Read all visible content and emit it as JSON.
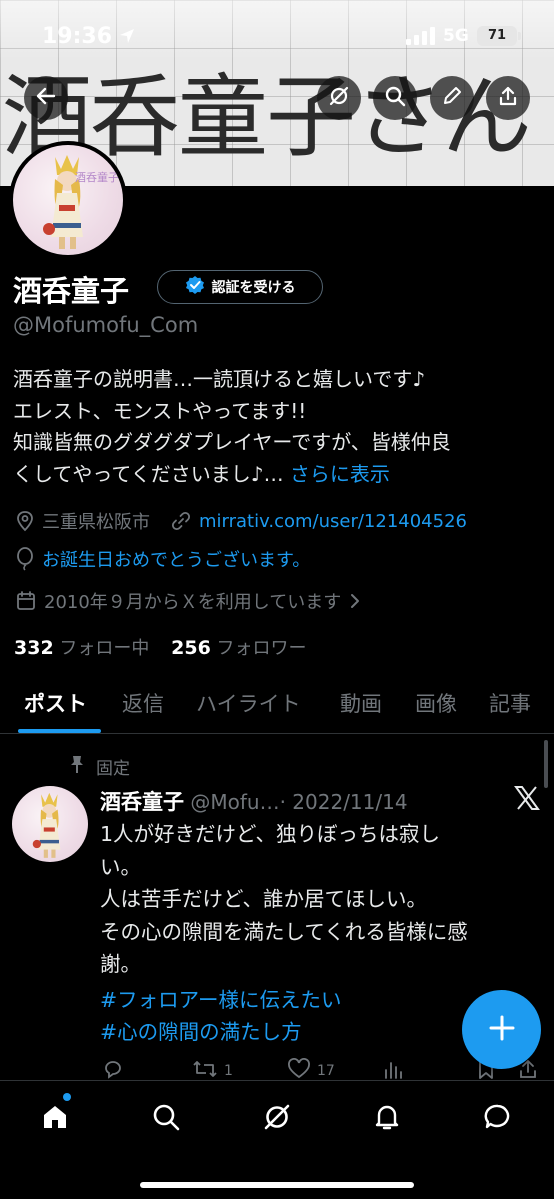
{
  "status_bar": {
    "time": "19:36",
    "network": "5G",
    "battery": "71"
  },
  "banner": {
    "text": "酒呑童子さん"
  },
  "header": {
    "back_icon": "arrow-left-icon",
    "grok_icon": "grok-icon",
    "search_icon": "search-icon",
    "edit_icon": "pencil-icon",
    "share_icon": "share-icon"
  },
  "profile": {
    "avatar_label": "酒呑童子",
    "display_name": "酒呑童子",
    "verify_button": "認証を受ける",
    "handle": "@Mofumofu_Com",
    "bio": "酒呑童子の説明書…一読頂けると嬉しいです♪\nエレスト、モンストやってます!!\n知識皆無のグダグダプレイヤーですが、皆様仲良\nくしてやってくださいまし♪… ",
    "bio_more": "さらに表示",
    "location": "三重県松阪市",
    "website": "mirrativ.com/user/121404526",
    "birthday": "お誕生日おめでとうございます。",
    "joined": "2010年９月からＸを利用しています",
    "following_count": "332",
    "following_label": "フォロー中",
    "followers_count": "256",
    "followers_label": "フォロワー"
  },
  "tabs": [
    "ポスト",
    "返信",
    "ハイライト",
    "動画",
    "画像",
    "記事"
  ],
  "active_tab": "ポスト",
  "post": {
    "pinned_label": "固定",
    "author_name": "酒呑童子",
    "author_handle": "@Mofu…",
    "date": "· 2022/11/14",
    "body": "1人が好きだけど、独りぼっちは寂し\nい。\n人は苦手だけど、誰か居てほしい。\nその心の隙間を満たしてくれる皆様に感\n謝。",
    "hashtag1": "#フォロアー様に伝えたい",
    "hashtag2": "#心の隙間の満たし方",
    "retweets": "1",
    "likes": "17"
  },
  "colors": {
    "accent": "#1d9bf0",
    "background": "#000000",
    "muted": "#71767b"
  }
}
